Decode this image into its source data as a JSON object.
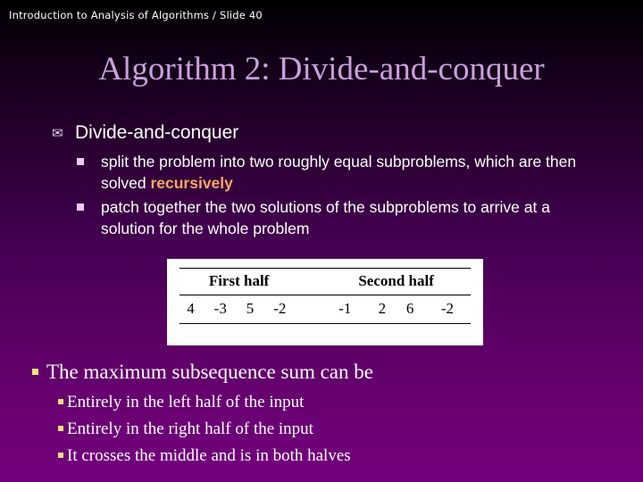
{
  "slide": {
    "header": "Introduction to Analysis of Algorithms / Slide 40",
    "title": "Algorithm 2: Divide-and-conquer",
    "colors": {
      "background_top": "#000000",
      "background_bottom": "#73007C",
      "title_text": "#C9A0DC",
      "body_text": "#FFFFFF",
      "highlight_orange": "#F9A766",
      "bullet_yellow": "#F2E37A",
      "bullet_pink": "#F0C8F5",
      "table_background": "#FFFFFF",
      "table_text": "#000000"
    }
  },
  "main_bullet": {
    "marker_icon": "envelope-icon",
    "marker_glyph": "✉",
    "label": "Divide-and-conquer",
    "sub_bullets": [
      {
        "marker_icon": "square-bullet-icon",
        "text_before": "split the problem into two roughly equal subproblems, which are then solved ",
        "highlight": "recursively",
        "text_after": ""
      },
      {
        "marker_icon": "square-bullet-icon",
        "text_before": "patch together the two solutions of the subproblems to arrive at a solution for the whole problem",
        "highlight": "",
        "text_after": ""
      }
    ]
  },
  "figure": {
    "headers": [
      "First half",
      "Second half"
    ],
    "left_values": [
      "4",
      "-3",
      "5",
      "-2"
    ],
    "right_values": [
      "-1",
      "2",
      "6",
      "-2"
    ]
  },
  "bottom_bullet": {
    "marker_icon": "section-bullet-icon",
    "label": "The maximum subsequence sum can be",
    "sub_bullets": [
      {
        "marker_icon": "section-bullet-icon",
        "text": "Entirely in the left half of the input"
      },
      {
        "marker_icon": "section-bullet-icon",
        "text": "Entirely in the right half of the input"
      },
      {
        "marker_icon": "section-bullet-icon",
        "text": "It crosses the middle and is in both halves"
      }
    ]
  }
}
